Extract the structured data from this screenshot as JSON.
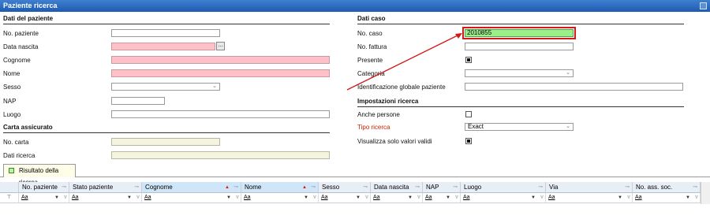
{
  "window": {
    "title": "Paziente ricerca"
  },
  "left": {
    "section_title": "Dati del paziente",
    "fields": {
      "no_paziente": "No. paziente",
      "data_nascita": "Data nascita",
      "cognome": "Cognome",
      "nome": "Nome",
      "sesso": "Sesso",
      "nap": "NAP",
      "luogo": "Luogo"
    },
    "calendar_button": "...",
    "insurance_title": "Carta assicurato",
    "no_carta": "No. carta",
    "dati_ricerca": "Dati ricerca"
  },
  "right": {
    "section_title": "Dati caso",
    "no_caso": {
      "label": "No. caso",
      "value": "2010855"
    },
    "no_fattura": "No. fattura",
    "presente": {
      "label": "Presente",
      "checked": true
    },
    "categoria": "Categoria",
    "identificazione": "Identificazione globale paziente",
    "settings_title": "Impostazioni ricerca",
    "anche_persone": {
      "label": "Anche persone",
      "checked": false
    },
    "tipo_ricerca": {
      "label": "Tipo ricerca",
      "value": "Exact"
    },
    "visualizza": {
      "label": "Visualizza solo valori validi",
      "checked": true
    }
  },
  "tab": {
    "label": "Risultato della ricerca"
  },
  "grid": {
    "columns": [
      "No. paziente",
      "Stato paziente",
      "Cognome",
      "Nome",
      "Sesso",
      "Data nascita",
      "NAP",
      "Luogo",
      "Via",
      "No. ass. soc."
    ],
    "filter_text": "Aa",
    "sorted_columns": [
      "Cognome",
      "Nome"
    ]
  },
  "colors": {
    "title_bar": "#1d5bb0",
    "required_field": "#ffc0c8",
    "highlight_field": "#9bf08a",
    "annotation": "#d21a1a"
  }
}
